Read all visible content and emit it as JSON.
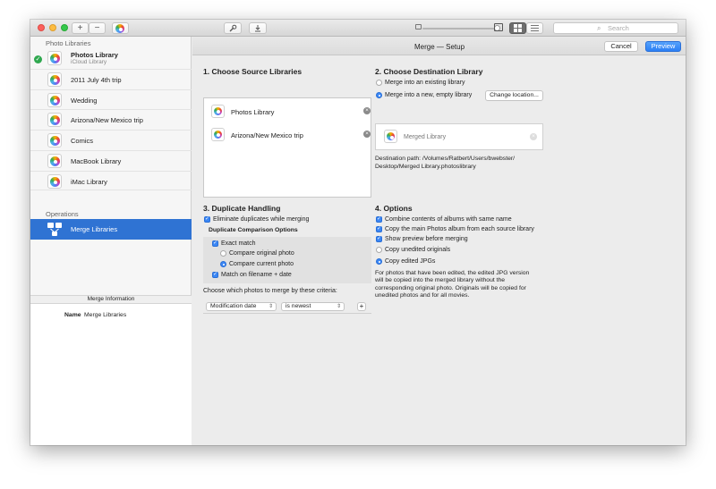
{
  "toolbar": {
    "add_label": "+",
    "remove_label": "−",
    "search_placeholder": "Search"
  },
  "sidebar": {
    "photo_libraries_heading": "Photo Libraries",
    "libraries": [
      {
        "label": "Photos Library",
        "sublabel": "iCloud Library",
        "active": true
      },
      {
        "label": "2011 July 4th trip"
      },
      {
        "label": "Wedding"
      },
      {
        "label": "Arizona/New Mexico trip"
      },
      {
        "label": "Comics"
      },
      {
        "label": "MacBook Library"
      },
      {
        "label": "iMac Library"
      }
    ],
    "operations_heading": "Operations",
    "operation_selected": "Merge Libraries"
  },
  "merge_info": {
    "heading": "Merge Information",
    "name_key": "Name",
    "name_value": "Merge Libraries"
  },
  "main": {
    "title": "Merge — Setup",
    "cancel_label": "Cancel",
    "preview_label": "Preview",
    "source": {
      "heading": "1. Choose Source Libraries",
      "items": [
        "Photos Library",
        "Arizona/New Mexico trip"
      ]
    },
    "destination": {
      "heading": "2. Choose Destination Library",
      "option_existing": "Merge into an existing library",
      "option_new": "Merge into a new, empty library",
      "change_location_label": "Change location...",
      "library_name": "Merged Library",
      "path_line1": "Destination path: /Volumes/Ratbert/Users/bwebster/",
      "path_line2": "Desktop/Merged Library.photoslibrary"
    },
    "duplicates": {
      "heading": "3. Duplicate Handling",
      "eliminate": "Eliminate duplicates while merging",
      "comparison_heading": "Duplicate Comparison Options",
      "exact_match": "Exact match",
      "compare_original": "Compare original photo",
      "compare_current": "Compare current photo",
      "match_filename": "Match on filename + date",
      "criteria_label": "Choose which photos to merge by these criteria:",
      "criteria_field": "Modification date",
      "criteria_op": "is newest",
      "add_label": "+"
    },
    "options": {
      "heading": "4. Options",
      "items": [
        {
          "label": "Combine contents of albums with same name",
          "checked": true
        },
        {
          "label": "Copy the main Photos album from each source library",
          "checked": true
        },
        {
          "label": "Show preview before merging",
          "checked": true
        },
        {
          "label": "Copy unedited originals",
          "checked": false
        },
        {
          "label": "Copy edited JPGs",
          "checked": true
        }
      ],
      "note_lines": [
        "For photos that have been edited, the edited JPG version",
        "will be copied into the merged library without the",
        "corresponding original photo. Originals will be copied for",
        "unedited photos and for all movies."
      ]
    }
  },
  "colors": {
    "accent": "#2f73d3",
    "checkbox": "#3b87f5",
    "success": "#2fa84f"
  }
}
